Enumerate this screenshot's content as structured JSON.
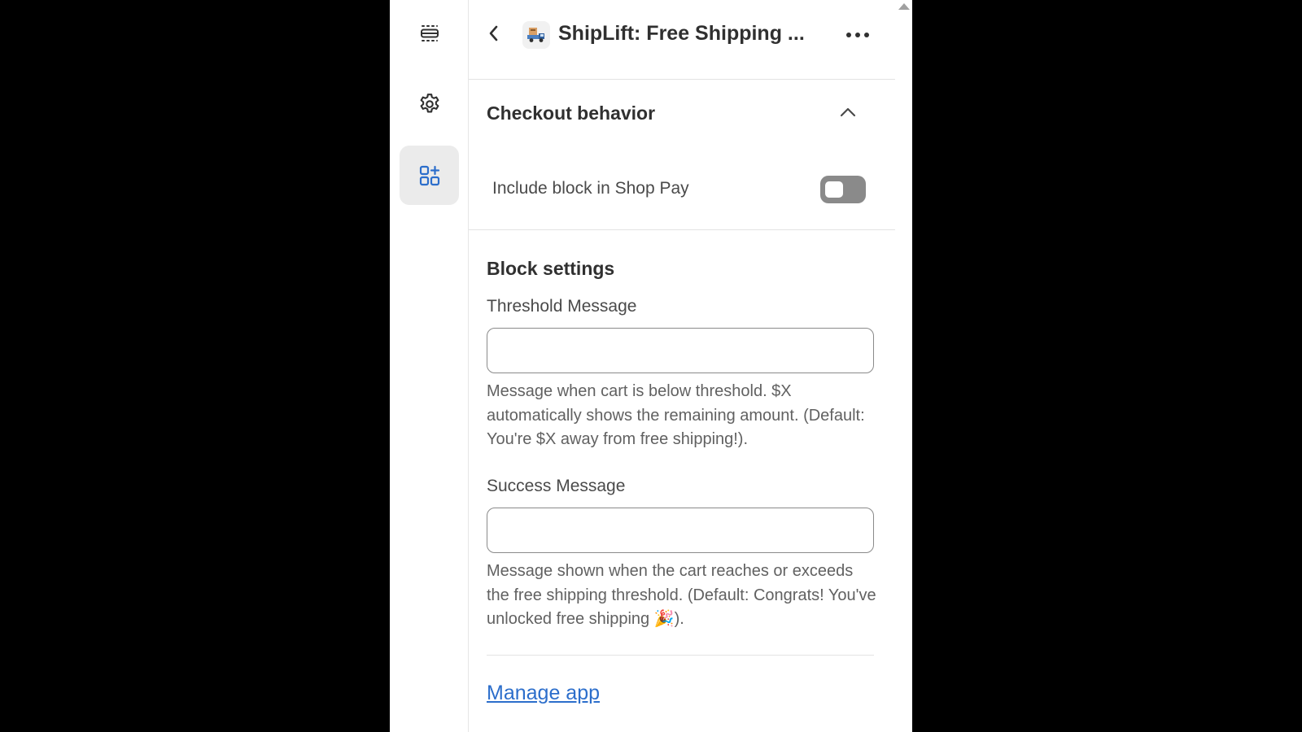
{
  "rail": {
    "items": [
      {
        "icon": "sections-icon",
        "active": false
      },
      {
        "icon": "gear-icon",
        "active": false
      },
      {
        "icon": "apps-add-icon",
        "active": true
      }
    ]
  },
  "header": {
    "title": "ShipLift: Free Shipping ...",
    "app_icon": "shiplift-truck-icon"
  },
  "checkout_behavior": {
    "title": "Checkout behavior",
    "toggle_label": "Include block in Shop Pay",
    "toggle_on": false
  },
  "block_settings": {
    "title": "Block settings",
    "threshold": {
      "label": "Threshold Message",
      "value": "",
      "help": "Message when cart is below threshold. $X automatically shows the remaining amount. (Default: You're $X away from free shipping!)."
    },
    "success": {
      "label": "Success Message",
      "value": "",
      "help_text": "Message shown when the cart reaches or exceeds the free shipping threshold. (Default: Congrats! You've unlocked free shipping ",
      "help_emoji": "🎉",
      "help_suffix": ")."
    }
  },
  "footer": {
    "manage_link": "Manage app"
  },
  "colors": {
    "accent_blue": "#2c6ecb",
    "toggle_off": "#8a8a8a",
    "active_rail_bg": "#ebebeb"
  }
}
